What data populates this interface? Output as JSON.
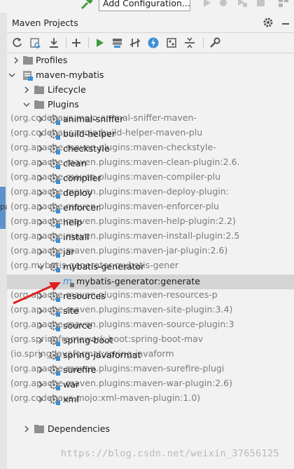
{
  "topbar": {
    "add_configuration": "Add Configuration..."
  },
  "panel": {
    "title": "Maven Projects"
  },
  "tree": {
    "profiles": "Profiles",
    "project": "maven-mybatis",
    "lifecycle": "Lifecycle",
    "plugins_label": "Plugins",
    "plugins": [
      {
        "name": "animal-sniffer",
        "artifact": "(org.codehaus.mojo:animal-sniffer-maven-"
      },
      {
        "name": "build-helper",
        "artifact": "(org.codehaus.mojo:build-helper-maven-plu"
      },
      {
        "name": "checkstyle",
        "artifact": "(org.apache.maven.plugins:maven-checkstyle-"
      },
      {
        "name": "clean",
        "artifact": "(org.apache.maven.plugins:maven-clean-plugin:2.6."
      },
      {
        "name": "compiler",
        "artifact": "(org.apache.maven.plugins:maven-compiler-plu"
      },
      {
        "name": "deploy",
        "artifact": "(org.apache.maven.plugins:maven-deploy-plugin:"
      },
      {
        "name": "enforcer",
        "artifact": "(org.apache.maven.plugins:maven-enforcer-plu"
      },
      {
        "name": "help",
        "artifact": "(org.apache.maven.plugins:maven-help-plugin:2.2)"
      },
      {
        "name": "install",
        "artifact": "(org.apache.maven.plugins:maven-install-plugin:2.5"
      },
      {
        "name": "jar",
        "artifact": "(org.apache.maven.plugins:maven-jar-plugin:2.6)"
      },
      {
        "name": "mybatis-generator",
        "artifact": "(org.mybatis.generator:mybatis-gener"
      }
    ],
    "goal": "mybatis-generator:generate",
    "plugins_after": [
      {
        "name": "resources",
        "artifact": "(org.apache.maven.plugins:maven-resources-p"
      },
      {
        "name": "site",
        "artifact": "(org.apache.maven.plugins:maven-site-plugin:3.4)"
      },
      {
        "name": "source",
        "artifact": "(org.apache.maven.plugins:maven-source-plugin:3"
      },
      {
        "name": "spring-boot",
        "artifact": "(org.springframework.boot:spring-boot-mav"
      },
      {
        "name": "spring-javaformat",
        "artifact": "(io.spring.javaformat:spring-javaform"
      },
      {
        "name": "surefire",
        "artifact": "(org.apache.maven.plugins:maven-surefire-plugi"
      },
      {
        "name": "war",
        "artifact": "(org.apache.maven.plugins:maven-war-plugin:2.6)"
      },
      {
        "name": "xml",
        "artifact": "(org.codehaus.mojo:xml-maven-plugin:1.0)"
      }
    ],
    "dependencies": "Dependencies"
  },
  "left_strip": {
    "fragment": "pa"
  },
  "watermark": "https://blog.csdn.net/weixin_37656125",
  "colors": {
    "panel_bg": "#f2f2f2",
    "selected_row": "#d4d4d4",
    "run_green": "#3c9c3c",
    "blue_icon": "#3b8fd6",
    "arrow_red": "#e02020"
  }
}
